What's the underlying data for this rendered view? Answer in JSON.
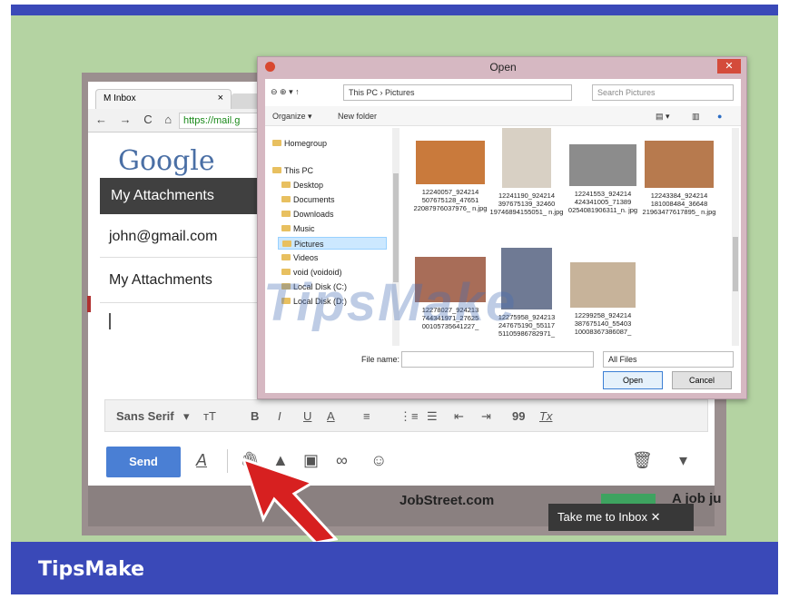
{
  "browser": {
    "tab_title": "M Inbox",
    "tab_close": "×",
    "nav_glyphs": [
      "←",
      "→",
      "C",
      "⌂"
    ],
    "url": "https://mail.g"
  },
  "gmail": {
    "logo": "Google",
    "compose_header": "My Attachments",
    "to_value": "john@gmail.com",
    "subject_value": "My Attachments",
    "format_bar": {
      "font": "Sans Serif",
      "font_caret": "▾",
      "size": "тT",
      "bold": "B",
      "italic": "I",
      "underline": "U",
      "text_color": "A",
      "align": "≡",
      "numbered": "⋮≡",
      "bulleted": "☰",
      "indent_less": "⇤",
      "indent_more": "⇥",
      "quote": "99",
      "clear": "Tx"
    },
    "send_label": "Send",
    "inbox_sender": "JobStreet.com",
    "inbox_snippet_fragment": "A job ju",
    "take_me_to_inbox": "Take me to Inbox ✕"
  },
  "dialog": {
    "title": "Open",
    "close": "✕",
    "breadcrumb": "This PC  ›  Pictures",
    "search_placeholder": "Search Pictures",
    "organize": "Organize ▾",
    "new_folder": "New folder",
    "nav_items": [
      {
        "label": "Homegroup",
        "indent": 0,
        "selected": false
      },
      {
        "label": "This PC",
        "indent": 0,
        "selected": false
      },
      {
        "label": "Desktop",
        "indent": 1,
        "selected": false
      },
      {
        "label": "Documents",
        "indent": 1,
        "selected": false
      },
      {
        "label": "Downloads",
        "indent": 1,
        "selected": false
      },
      {
        "label": "Music",
        "indent": 1,
        "selected": false
      },
      {
        "label": "Pictures",
        "indent": 1,
        "selected": true
      },
      {
        "label": "Videos",
        "indent": 1,
        "selected": false
      },
      {
        "label": "void (voidoid)",
        "indent": 1,
        "selected": false
      },
      {
        "label": "Local Disk (C:)",
        "indent": 1,
        "selected": false
      },
      {
        "label": "Local Disk (D:)",
        "indent": 1,
        "selected": false
      }
    ],
    "files": [
      {
        "name": "12240057_924214 507675128_47651 22087976037976_ n.jpg",
        "color": "#c97a3c"
      },
      {
        "name": "12241190_924214 397675139_32460 19746894155051_ n.jpg",
        "color": "#d8d0c4"
      },
      {
        "name": "12241553_924214 424341005_71389 0254081906311_n. jpg",
        "color": "#8c8c8c"
      },
      {
        "name": "12243384_924214 181008484_36648 21963477617895_ n.jpg",
        "color": "#b77a4e"
      },
      {
        "name": "12278027_924213 744341971_27625 00105735641227_",
        "color": "#a86d58"
      },
      {
        "name": "12275958_924213 247675190_55117 51105986782971_",
        "color": "#6f7a94"
      },
      {
        "name": "12299258_924214 387675140_55403 10008367386087_",
        "color": "#c7b39a"
      }
    ],
    "file_name_label": "File name:",
    "file_type": "All Files",
    "open_label": "Open",
    "cancel_label": "Cancel"
  },
  "brand": {
    "footer": "TipsMake",
    "watermark": "TipsMake"
  }
}
